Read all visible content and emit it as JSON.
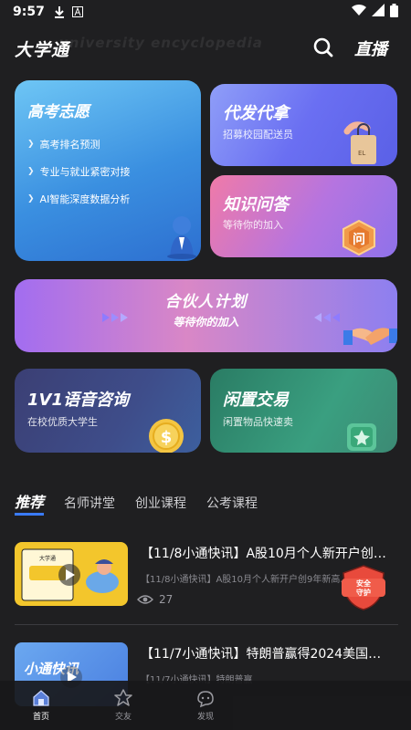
{
  "status_bar": {
    "time": "9:57"
  },
  "header": {
    "app_title": "大学通",
    "watermark": "university encyclopedia",
    "live_label": "直播",
    "search_icon": "search-icon"
  },
  "cards": {
    "gaokao": {
      "title": "高考志愿",
      "items": [
        "高考排名预测",
        "专业与就业紧密对接",
        "AI智能深度数据分析"
      ]
    },
    "daifa": {
      "title": "代发代拿",
      "subtitle": "招募校园配送员"
    },
    "zhishi": {
      "title": "知识问答",
      "subtitle": "等待你的加入",
      "badge_char": "问"
    },
    "huoban": {
      "title": "合伙人计划",
      "subtitle": "等待你的加入"
    },
    "yuyin": {
      "title": "1V1语音咨询",
      "subtitle": "在校优质大学生",
      "coin_char": "$"
    },
    "xianzhi": {
      "title": "闲置交易",
      "subtitle": "闲置物品快速卖"
    }
  },
  "tabs": [
    {
      "label": "推荐",
      "active": true
    },
    {
      "label": "名师讲堂",
      "active": false
    },
    {
      "label": "创业课程",
      "active": false
    },
    {
      "label": "公考课程",
      "active": false
    }
  ],
  "news": [
    {
      "title": "【11/8小通快讯】A股10月个人新开户创…",
      "snippet": "【11/8小通快讯】A股10月个人新开户创9年新高·小",
      "views": "27"
    },
    {
      "title": "【11/7小通快讯】特朗普赢得2024美国…",
      "snippet": "【11/7小通快讯】特朗普赢"
    }
  ],
  "thumb_texts": {
    "first_small": "大学通",
    "second": "小通快讯"
  },
  "safety_badge": {
    "line1": "安全",
    "line2": "守护"
  },
  "bottom_nav": [
    {
      "label": "首页",
      "icon": "home-icon",
      "active": true
    },
    {
      "label": "交友",
      "icon": "friends-icon",
      "active": false
    },
    {
      "label": "发现",
      "icon": "discover-icon",
      "active": false
    }
  ],
  "colors": {
    "background": "#1f1f21",
    "accent_blue": "#3a7bff",
    "badge_red": "#e84a3c"
  }
}
